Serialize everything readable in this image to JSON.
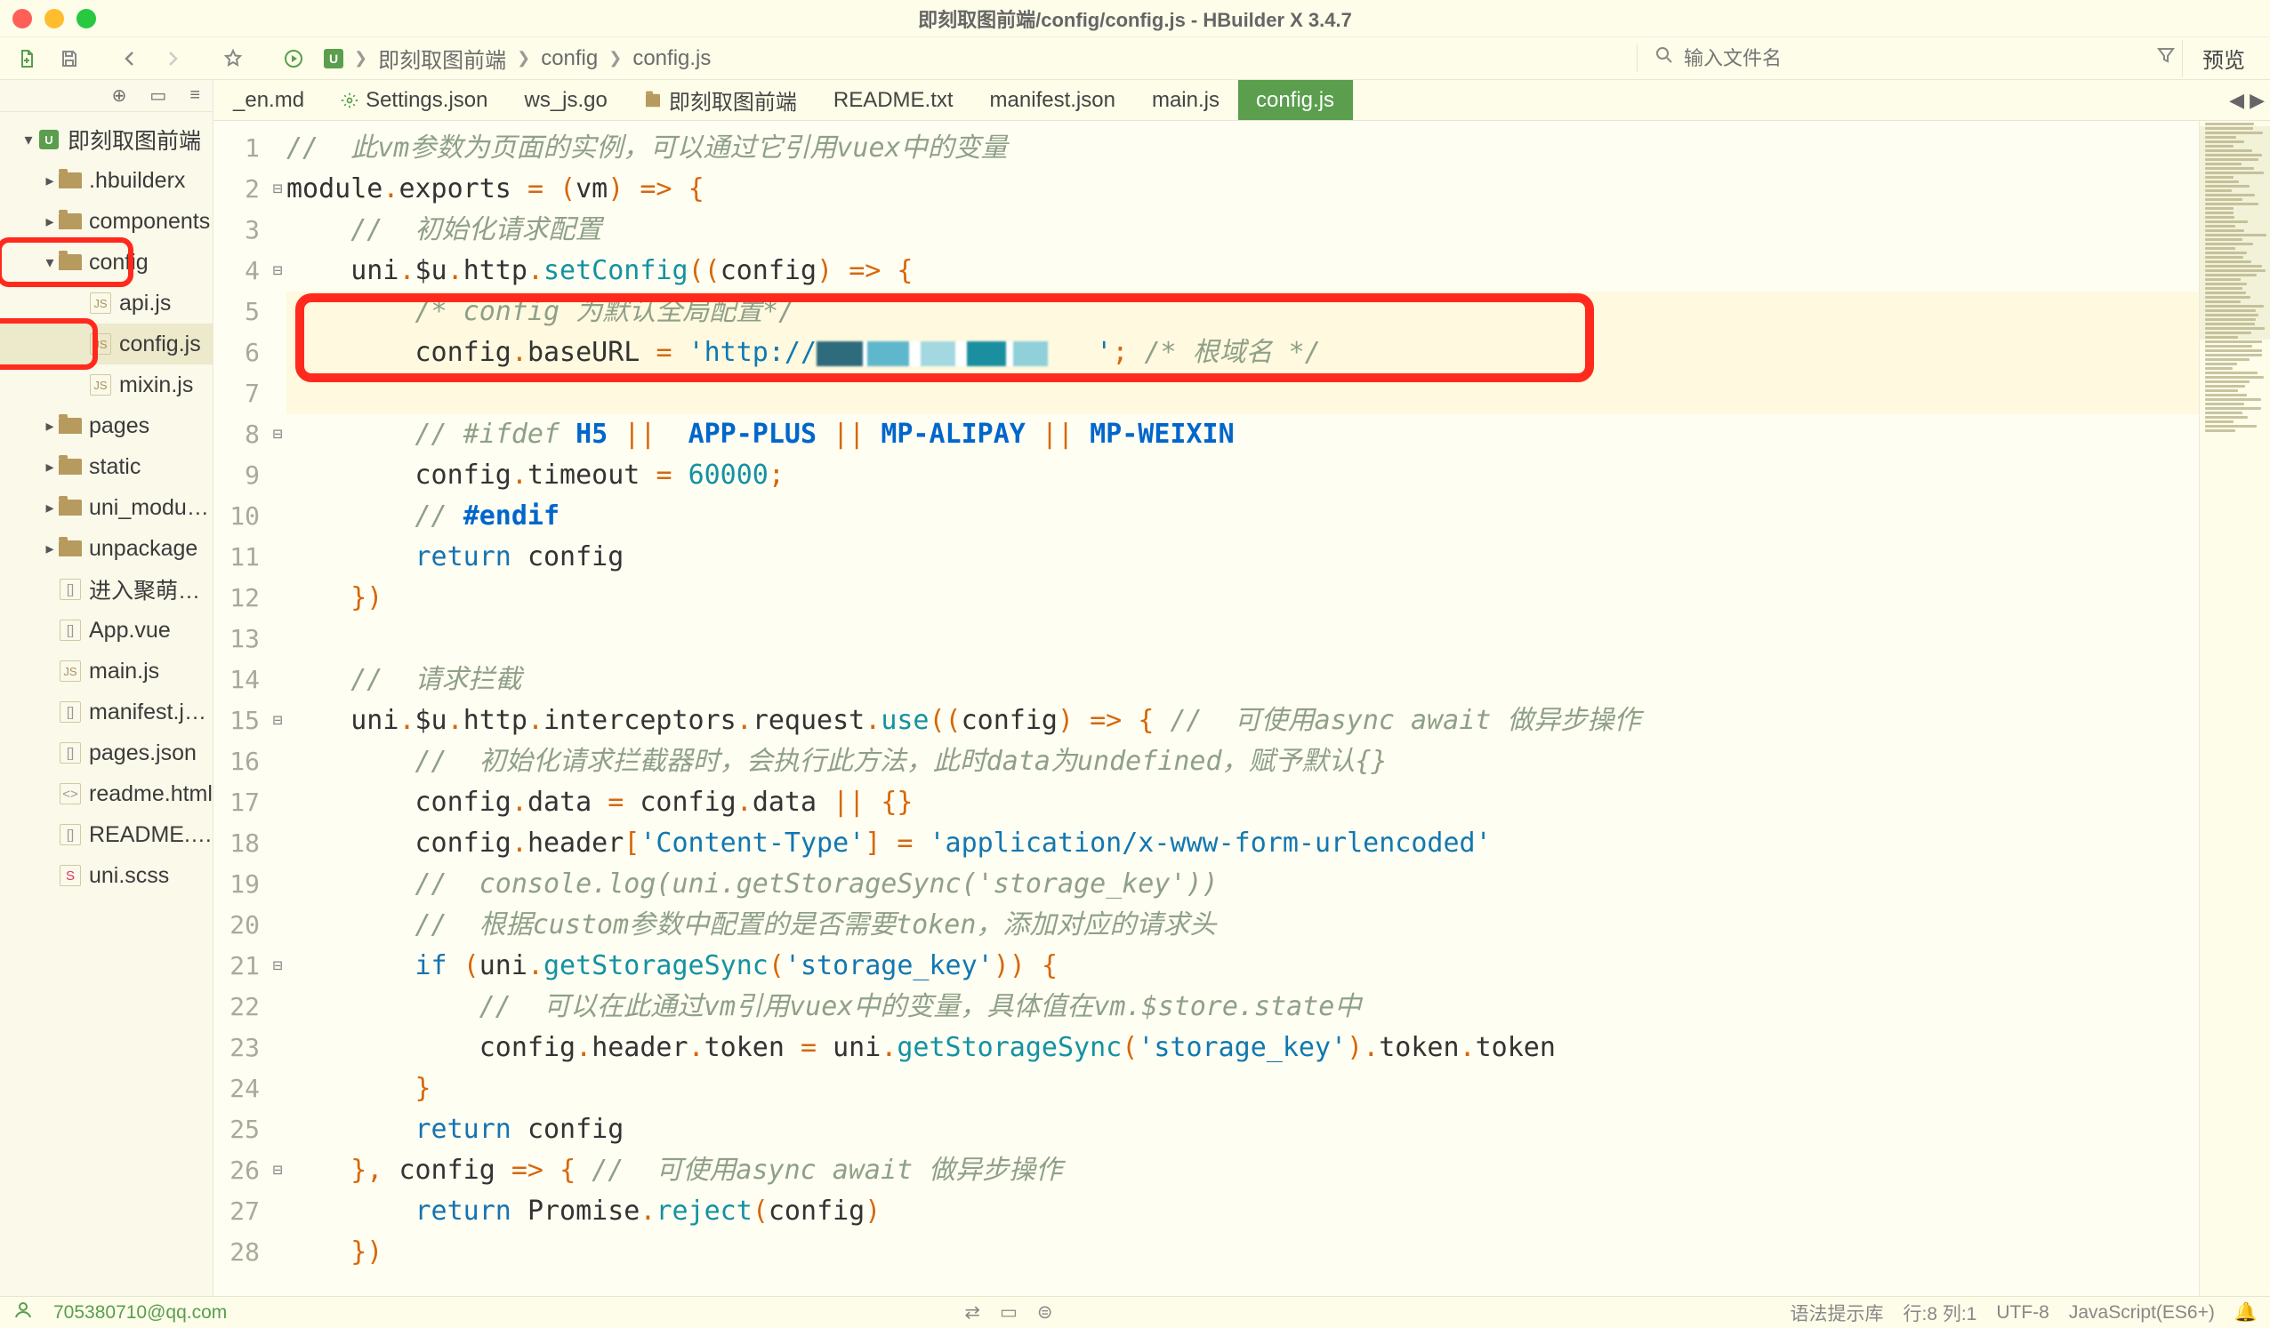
{
  "titlebar": {
    "title": "即刻取图前端/config/config.js - HBuilder X 3.4.7"
  },
  "toolbar": {
    "search_placeholder": "输入文件名",
    "preview": "预览"
  },
  "breadcrumb": {
    "items": [
      "即刻取图前端",
      "config",
      "config.js"
    ]
  },
  "sidebar": {
    "project": "即刻取图前端",
    "items": [
      {
        "type": "folder",
        "label": ".hbuilderx",
        "depth": 1,
        "expandable": true
      },
      {
        "type": "folder",
        "label": "components",
        "depth": 1,
        "expandable": true
      },
      {
        "type": "folder",
        "label": "config",
        "depth": 1,
        "expandable": true,
        "expanded": true,
        "redbox": 1
      },
      {
        "type": "js",
        "label": "api.js",
        "depth": 2
      },
      {
        "type": "js",
        "label": "config.js",
        "depth": 2,
        "active": true,
        "redbox": 2
      },
      {
        "type": "js",
        "label": "mixin.js",
        "depth": 2
      },
      {
        "type": "folder",
        "label": "pages",
        "depth": 1,
        "expandable": true
      },
      {
        "type": "folder",
        "label": "static",
        "depth": 1,
        "expandable": true
      },
      {
        "type": "folder",
        "label": "uni_modules",
        "depth": 1,
        "expandable": true
      },
      {
        "type": "folder",
        "label": "unpackage",
        "depth": 1,
        "expandable": true
      },
      {
        "type": "txt",
        "label": "进入聚萌博客发现更...",
        "depth": 1
      },
      {
        "type": "txt",
        "label": "App.vue",
        "depth": 1
      },
      {
        "type": "js",
        "label": "main.js",
        "depth": 1
      },
      {
        "type": "txt",
        "label": "manifest.json",
        "depth": 1
      },
      {
        "type": "txt",
        "label": "pages.json",
        "depth": 1
      },
      {
        "type": "code",
        "label": "readme.html",
        "depth": 1
      },
      {
        "type": "txt",
        "label": "README.txt",
        "depth": 1
      },
      {
        "type": "scss",
        "label": "uni.scss",
        "depth": 1
      }
    ]
  },
  "tabs": {
    "items": [
      {
        "label": "_en.md",
        "icon": "",
        "hiddenPartial": true
      },
      {
        "label": "Settings.json",
        "icon": "gear"
      },
      {
        "label": "ws_js.go",
        "icon": ""
      },
      {
        "label": "即刻取图前端",
        "icon": "folder"
      },
      {
        "label": "README.txt",
        "icon": ""
      },
      {
        "label": "manifest.json",
        "icon": ""
      },
      {
        "label": "main.js",
        "icon": ""
      },
      {
        "label": "config.js",
        "icon": "",
        "active": true
      }
    ]
  },
  "code": {
    "lines": [
      {
        "n": 1,
        "fold": "",
        "html": "<span class='cm'>//  此vm参数为页面的实例，可以通过它引用vuex中的变量</span>"
      },
      {
        "n": 2,
        "fold": "⊟",
        "html": "<span class='id'>module</span><span class='op'>.</span><span class='id'>exports</span> <span class='op'>=</span> <span class='op'>(</span><span class='id'>vm</span><span class='op'>)</span> <span class='op'>=&gt;</span> <span class='op'>{</span>"
      },
      {
        "n": 3,
        "fold": "",
        "html": "    <span class='cm'>//  初始化请求配置</span>"
      },
      {
        "n": 4,
        "fold": "⊟",
        "html": "    <span class='id'>uni</span><span class='op'>.</span><span class='id'>$u</span><span class='op'>.</span><span class='id'>http</span><span class='op'>.</span><span class='fn'>setConfig</span><span class='op'>((</span><span class='id'>config</span><span class='op'>)</span> <span class='op'>=&gt;</span> <span class='op'>{</span>"
      },
      {
        "n": 5,
        "fold": "",
        "html": "        <span class='cm'>/* config 为默认全局配置*/</span>",
        "hl": true
      },
      {
        "n": 6,
        "fold": "",
        "html": "        <span class='id'>config</span><span class='op'>.</span><span class='id'>baseURL</span> <span class='op'>=</span> <span class='str'>'http://</span><span class='censor'></span><span class='str'>   '</span><span class='op'>;</span> <span class='cm'>/* 根域名 */</span>",
        "hl": true
      },
      {
        "n": 7,
        "fold": "",
        "html": "",
        "hl": true
      },
      {
        "n": 8,
        "fold": "⊟",
        "html": "        <span class='cm'>// #ifdef </span><span class='blue'>H5</span> <span class='op'>||</span>  <span class='blue'>APP-PLUS</span> <span class='op'>||</span> <span class='blue'>MP-ALIPAY</span> <span class='op'>||</span> <span class='blue'>MP-WEIXIN</span>"
      },
      {
        "n": 9,
        "fold": "",
        "html": "        <span class='id'>config</span><span class='op'>.</span><span class='id'>timeout</span> <span class='op'>=</span> <span class='num'>60000</span><span class='op'>;</span>"
      },
      {
        "n": 10,
        "fold": "",
        "html": "        <span class='cm'>// </span><span class='blue'>#endif</span>"
      },
      {
        "n": 11,
        "fold": "",
        "html": "        <span class='kw'>return</span> <span class='id'>config</span>"
      },
      {
        "n": 12,
        "fold": "",
        "html": "    <span class='op'>})</span>"
      },
      {
        "n": 13,
        "fold": "",
        "html": ""
      },
      {
        "n": 14,
        "fold": "",
        "html": "    <span class='cm'>//  请求拦截</span>"
      },
      {
        "n": 15,
        "fold": "⊟",
        "html": "    <span class='id'>uni</span><span class='op'>.</span><span class='id'>$u</span><span class='op'>.</span><span class='id'>http</span><span class='op'>.</span><span class='id'>interceptors</span><span class='op'>.</span><span class='id'>request</span><span class='op'>.</span><span class='fn'>use</span><span class='op'>((</span><span class='id'>config</span><span class='op'>)</span> <span class='op'>=&gt;</span> <span class='op'>{</span> <span class='cm'>//  可使用async await 做异步操作</span>"
      },
      {
        "n": 16,
        "fold": "",
        "html": "        <span class='cm'>//  初始化请求拦截器时，会执行此方法，此时data为undefined，赋予默认{}</span>"
      },
      {
        "n": 17,
        "fold": "",
        "html": "        <span class='id'>config</span><span class='op'>.</span><span class='id'>data</span> <span class='op'>=</span> <span class='id'>config</span><span class='op'>.</span><span class='id'>data</span> <span class='op'>||</span> <span class='op'>{}</span>"
      },
      {
        "n": 18,
        "fold": "",
        "html": "        <span class='id'>config</span><span class='op'>.</span><span class='id'>header</span><span class='op'>[</span><span class='str'>'Content-Type'</span><span class='op'>]</span> <span class='op'>=</span> <span class='str'>'application/x-www-form-urlencoded'</span>"
      },
      {
        "n": 19,
        "fold": "",
        "html": "        <span class='cm'>//  console.log(uni.getStorageSync('storage_key'))</span>"
      },
      {
        "n": 20,
        "fold": "",
        "html": "        <span class='cm'>//  根据custom参数中配置的是否需要token，添加对应的请求头</span>"
      },
      {
        "n": 21,
        "fold": "⊟",
        "html": "        <span class='kw'>if</span> <span class='op'>(</span><span class='id'>uni</span><span class='op'>.</span><span class='fn'>getStorageSync</span><span class='op'>(</span><span class='str'>'storage_key'</span><span class='op'>))</span> <span class='op'>{</span>"
      },
      {
        "n": 22,
        "fold": "",
        "html": "            <span class='cm'>//  可以在此通过vm引用vuex中的变量，具体值在vm.$store.state中</span>"
      },
      {
        "n": 23,
        "fold": "",
        "html": "            <span class='id'>config</span><span class='op'>.</span><span class='id'>header</span><span class='op'>.</span><span class='id'>token</span> <span class='op'>=</span> <span class='id'>uni</span><span class='op'>.</span><span class='fn'>getStorageSync</span><span class='op'>(</span><span class='str'>'storage_key'</span><span class='op'>)</span><span class='op'>.</span><span class='id'>token</span><span class='op'>.</span><span class='id'>token</span>"
      },
      {
        "n": 24,
        "fold": "",
        "html": "        <span class='op'>}</span>"
      },
      {
        "n": 25,
        "fold": "",
        "html": "        <span class='kw'>return</span> <span class='id'>config</span>"
      },
      {
        "n": 26,
        "fold": "⊟",
        "html": "    <span class='op'>},</span> <span class='id'>config</span> <span class='op'>=&gt;</span> <span class='op'>{</span> <span class='cm'>//  可使用async await 做异步操作</span>"
      },
      {
        "n": 27,
        "fold": "",
        "html": "        <span class='kw'>return</span> <span class='id'>Promise</span><span class='op'>.</span><span class='fn'>reject</span><span class='op'>(</span><span class='id'>config</span><span class='op'>)</span>"
      },
      {
        "n": 28,
        "fold": "",
        "html": "    <span class='op'>})</span>"
      }
    ]
  },
  "statusbar": {
    "user": "705380710@qq.com",
    "syntax_hint": "语法提示库",
    "pos": "行:8   列:1",
    "encoding": "UTF-8",
    "lang": "JavaScript(ES6+)"
  }
}
